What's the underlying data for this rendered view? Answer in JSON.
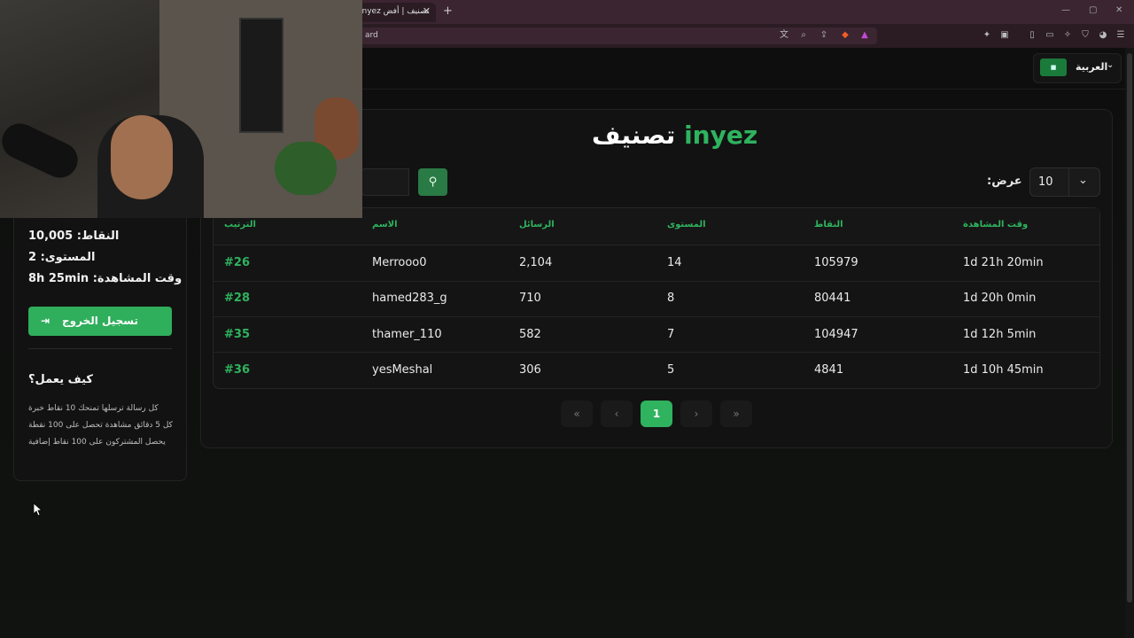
{
  "browser": {
    "tab_title": "inyez تصنيف | أفض",
    "tab_close": "✕",
    "new_tab": "+",
    "address": "ard",
    "win_min": "—",
    "win_max": "▢",
    "win_close": "✕"
  },
  "header": {
    "language_label": "العربية",
    "flag": "🇸🇦"
  },
  "sidebar": {
    "points": "النقاط: 10,005",
    "level": "المستوى: 2",
    "watch_time": "وقت المشاهدة: 8h 25min",
    "logout_label": "تسجيل الخروج",
    "how_title": "كيف يعمل؟",
    "how_lines": [
      "كل رسالة ترسلها تمنحك 10 نقاط خبرة",
      "كل 5 دقائق مشاهدة تحصل على 100 نقطة",
      "يحصل المشتركون على 100 نقاط إضافية"
    ]
  },
  "main": {
    "title_prefix": "تصنيف",
    "title_name": "inyez",
    "show_label": ":عرض",
    "show_value": "10",
    "columns": [
      "الترتيب",
      "الاسم",
      "الرسائل",
      "المستوى",
      "النقاط",
      "وقت المشاهدة"
    ],
    "rows": [
      {
        "rank": "#26",
        "name": "Merrooo0",
        "messages": "2,104",
        "level": "14",
        "points": "105979",
        "watch": "1d 21h 20min"
      },
      {
        "rank": "#28",
        "name": "hamed283_g",
        "messages": "710",
        "level": "8",
        "points": "80441",
        "watch": "1d 20h 0min"
      },
      {
        "rank": "#35",
        "name": "thamer_110",
        "messages": "582",
        "level": "7",
        "points": "104947",
        "watch": "1d 12h 5min"
      },
      {
        "rank": "#36",
        "name": "yesMeshal",
        "messages": "306",
        "level": "5",
        "points": "4841",
        "watch": "1d 10h 45min"
      }
    ],
    "pagination": {
      "first": "«",
      "prev": "‹",
      "current": "1",
      "next": "›",
      "last": "»"
    }
  },
  "colors": {
    "accent": "#2fb35f",
    "background": "#0d0d0d"
  }
}
